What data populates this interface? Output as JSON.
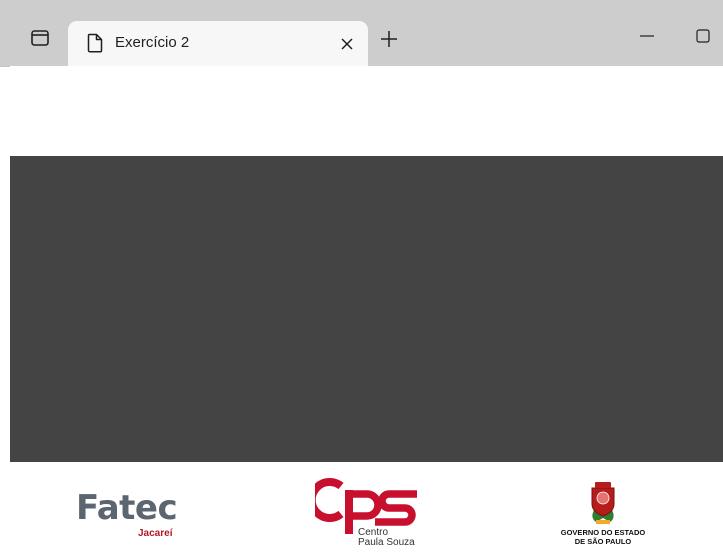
{
  "browser": {
    "tabs": [
      {
        "title": "Exercício 2",
        "active": true
      }
    ]
  },
  "footer": {
    "fatec": {
      "name": "Fatec",
      "campus": "Jacareí",
      "text_color": "#5b6670",
      "accent_color": "#b2182b"
    },
    "cps": {
      "caption_line1": "Centro",
      "caption_line2": "Paula Souza",
      "color": "#c8102e"
    },
    "sp_government": {
      "line1": "GOVERNO DO ESTADO",
      "line2": "DE SÃO PAULO"
    }
  },
  "colors": {
    "tabstrip": "#cdcdcd",
    "hero": "#444444",
    "page_background": "#ffffff"
  }
}
